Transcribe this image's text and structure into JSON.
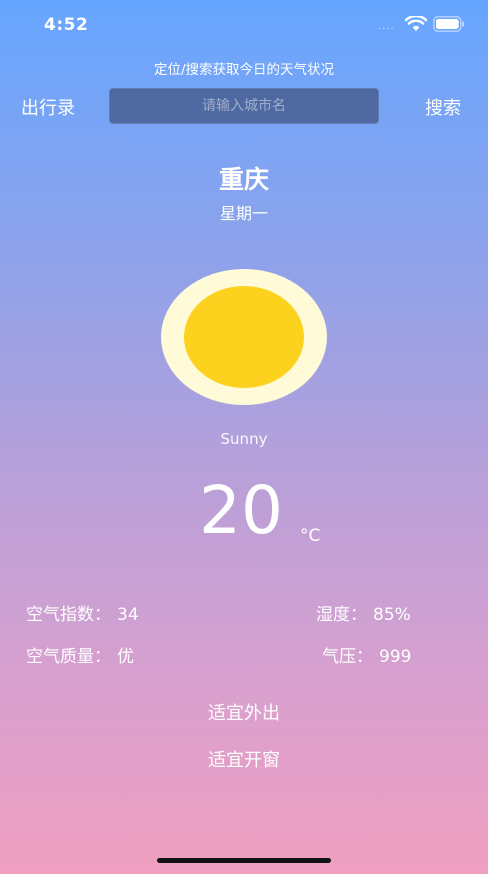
{
  "status_bar": {
    "time": "4:52",
    "signal_dots": "....",
    "icons": [
      "wifi-icon",
      "battery-icon"
    ]
  },
  "header": {
    "hint": "定位/搜索获取今日的天气状况"
  },
  "nav": {
    "travel_label": "出行录",
    "search_placeholder": "请输入城市名",
    "search_value": "",
    "search_label": "搜索"
  },
  "location": {
    "city": "重庆",
    "weekday": "星期一"
  },
  "weather": {
    "icon": "sun-icon",
    "condition": "Sunny",
    "temperature": "20",
    "unit": "°C"
  },
  "stats": {
    "aqi": {
      "label": "空气指数：",
      "value": "34"
    },
    "humidity": {
      "label": "湿度：",
      "value": "85%"
    },
    "quality": {
      "label": "空气质量：",
      "value": "优"
    },
    "pressure": {
      "label": "气压：",
      "value": "999"
    }
  },
  "advice": {
    "outing": "适宜外出",
    "window": "适宜开窗"
  },
  "colors": {
    "gradient_top": "#66a6ff",
    "gradient_bottom": "#f0a0c0",
    "sun_core": "#fdd21f",
    "sun_halo": "#fffbd9"
  }
}
